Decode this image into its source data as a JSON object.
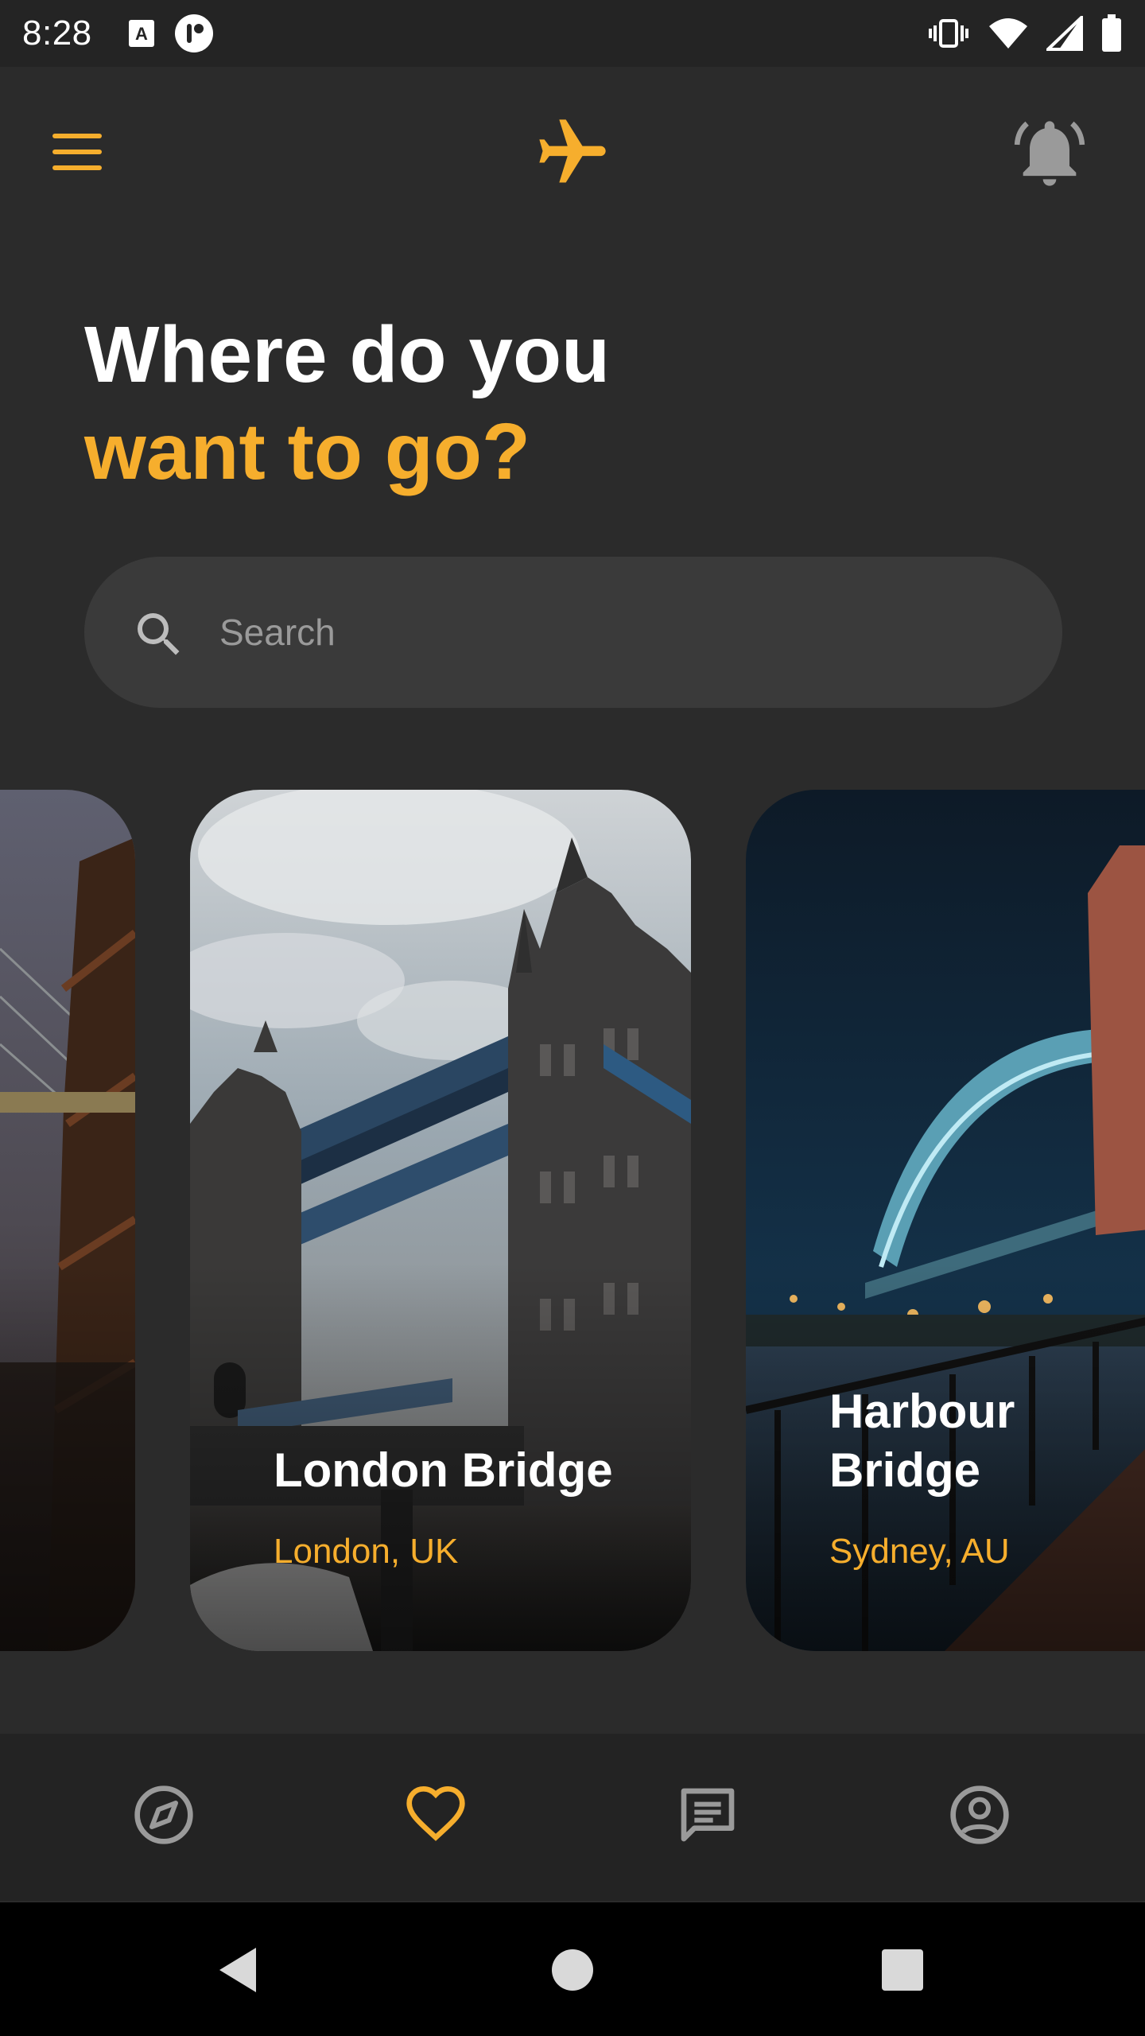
{
  "status_bar": {
    "time": "8:28"
  },
  "header": {
    "line1": "Where do you",
    "line2": "want to go?"
  },
  "search": {
    "placeholder": "Search",
    "value": ""
  },
  "cards": [
    {
      "title": "",
      "subtitle": ""
    },
    {
      "title": "London Bridge",
      "subtitle": "London, UK"
    },
    {
      "title": "Harbour Bridge",
      "subtitle": "Sydney, AU"
    }
  ],
  "bottom_nav": {
    "items": [
      "explore-icon",
      "favorites-icon",
      "messages-icon",
      "profile-icon"
    ],
    "active": "favorites-icon"
  },
  "colors": {
    "accent": "#f6ae2d",
    "background": "#2b2b2b",
    "search_bg": "#3a3a3a",
    "nav_bg": "#232323"
  }
}
